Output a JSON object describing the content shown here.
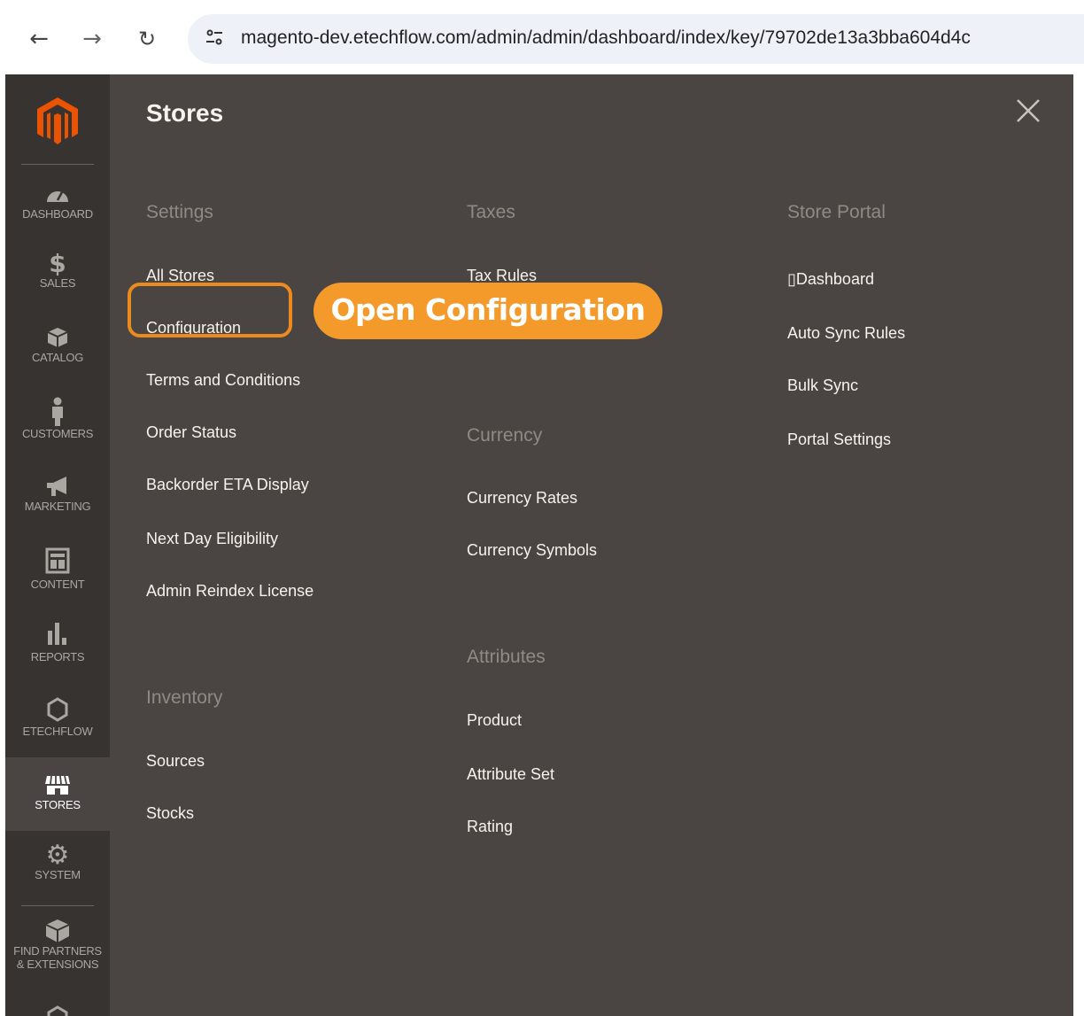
{
  "browser": {
    "url": "magento-dev.etechflow.com/admin/admin/dashboard/index/key/79702de13a3bba604d4c"
  },
  "sidebar": {
    "items": [
      {
        "label": "DASHBOARD",
        "icon": "dashboard-gauge-icon"
      },
      {
        "label": "SALES",
        "icon": "dollar-icon"
      },
      {
        "label": "CATALOG",
        "icon": "box-icon"
      },
      {
        "label": "CUSTOMERS",
        "icon": "person-icon"
      },
      {
        "label": "MARKETING",
        "icon": "megaphone-icon"
      },
      {
        "label": "CONTENT",
        "icon": "layout-icon"
      },
      {
        "label": "REPORTS",
        "icon": "bar-chart-icon"
      },
      {
        "label": "ETECHFLOW",
        "icon": "hexagon-icon"
      },
      {
        "label": "STORES",
        "icon": "storefront-icon"
      },
      {
        "label": "SYSTEM",
        "icon": "gear-icon"
      },
      {
        "label": "FIND PARTNERS",
        "label2": "& EXTENSIONS",
        "icon": "blocks-icon"
      }
    ],
    "active": "STORES"
  },
  "panel": {
    "title": "Stores",
    "settings": {
      "heading": "Settings",
      "links": [
        "All Stores",
        "Configuration",
        "Terms and Conditions",
        "Order Status",
        "Backorder ETA Display",
        "Next Day Eligibility",
        "Admin Reindex License"
      ]
    },
    "inventory": {
      "heading": "Inventory",
      "links": [
        "Sources",
        "Stocks"
      ]
    },
    "taxes": {
      "heading": "Taxes",
      "links": [
        "Tax Rules"
      ]
    },
    "currency": {
      "heading": "Currency",
      "links": [
        "Currency Rates",
        "Currency Symbols"
      ]
    },
    "attributes": {
      "heading": "Attributes",
      "links": [
        "Product",
        "Attribute Set",
        "Rating"
      ]
    },
    "store_portal": {
      "heading": "Store Portal",
      "links": [
        "▯Dashboard",
        "Auto Sync Rules",
        "Bulk Sync",
        "Portal Settings"
      ]
    }
  },
  "annotation": {
    "callout": "Open Configuration"
  },
  "colors": {
    "sidebar_bg": "#373330",
    "panel_bg": "#4a4542",
    "accent": "#f39a2b",
    "logo": "#eb5202"
  }
}
